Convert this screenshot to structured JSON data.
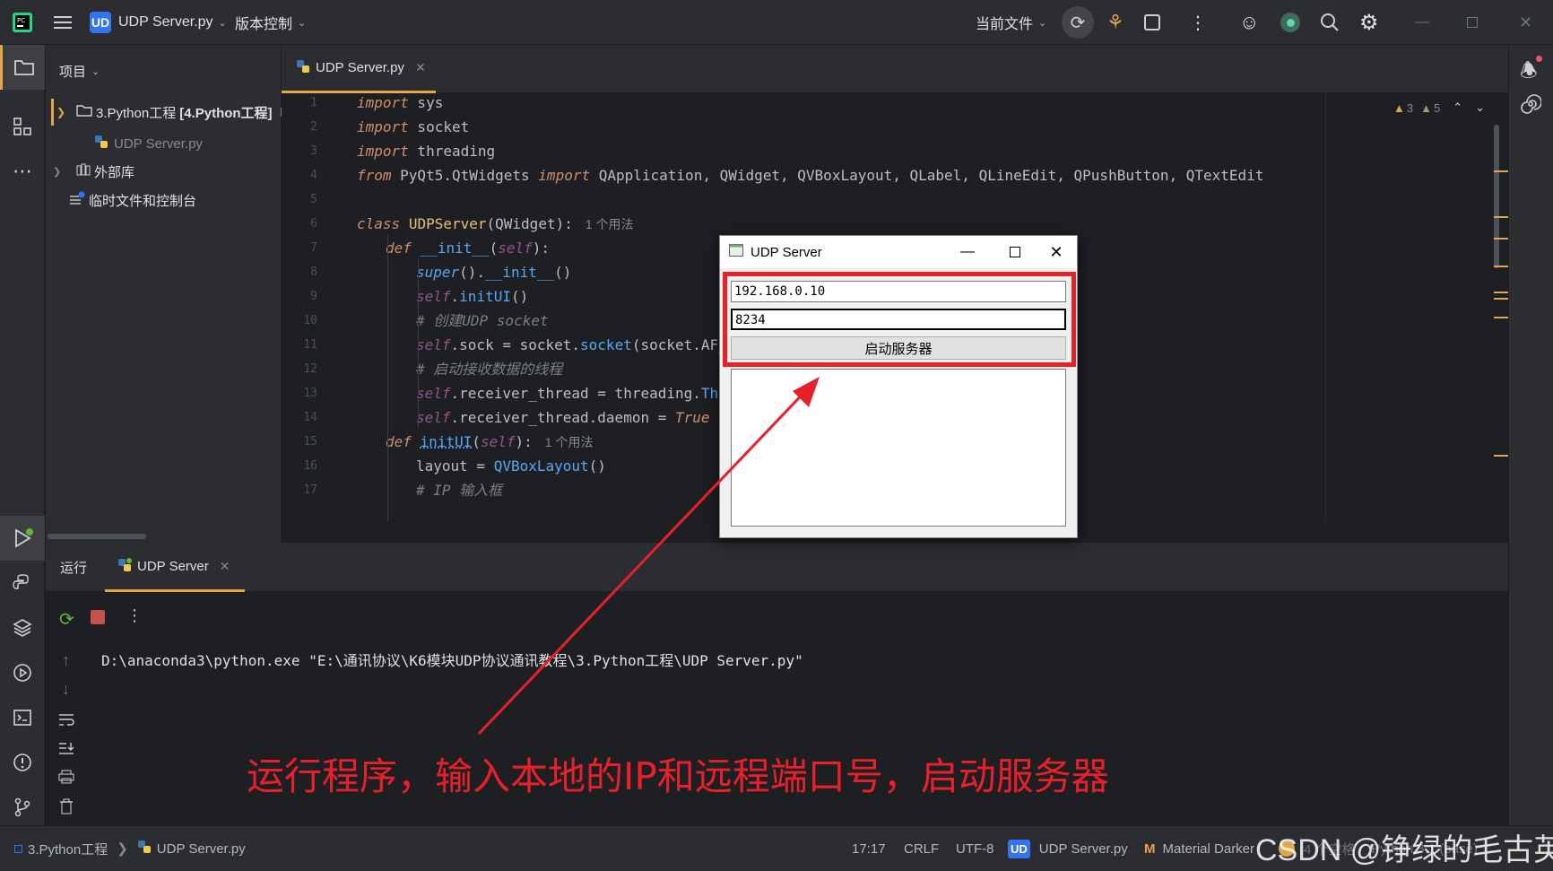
{
  "titlebar": {
    "project_badge": "UD",
    "project_name": "UDP Server.py",
    "vcs_menu": "版本控制",
    "run_config": "当前文件"
  },
  "project_panel": {
    "title": "项目",
    "root_label": "3.Python工程",
    "root_bold": "[4.Python工程]",
    "root_suffix": "E",
    "file_item": "UDP Server.py",
    "external_libs": "外部库",
    "scratches": "临时文件和控制台"
  },
  "editor": {
    "tab_label": "UDP Server.py",
    "warnings_count": "3",
    "weak_warnings_count": "5",
    "line_numbers": [
      "1",
      "2",
      "3",
      "4",
      "5",
      "6",
      "7",
      "8",
      "9",
      "10",
      "11",
      "12",
      "13",
      "14",
      "15",
      "16",
      "17"
    ],
    "usage_hint_1": "1 个用法",
    "usage_hint_2": "1 个用法"
  },
  "udp_window": {
    "title": "UDP Server",
    "ip_value": "192.168.0.10",
    "port_value": "8234",
    "start_button": "启动服务器"
  },
  "run_panel": {
    "run_label": "运行",
    "tab_label": "UDP Server",
    "console_line": "D:\\anaconda3\\python.exe \"E:\\通讯协议\\K6模块UDP协议通讯教程\\3.Python工程\\UDP Server.py\""
  },
  "annotation": "运行程序，输入本地的IP和远程端口号，启动服务器",
  "statusbar": {
    "breadcrumb_project": "3.Python工程",
    "breadcrumb_file": "UDP Server.py",
    "position": "17:17",
    "line_ending": "CRLF",
    "encoding": "UTF-8",
    "badge": "UD",
    "file_label": "UDP Server.py",
    "theme": "Material Darker",
    "interpreter_partial": "Python 3.1 (base)",
    "extra_partial": "4 个空格"
  },
  "watermark": "CSDN @铮绿的毛古英",
  "colors": {
    "accent": "#3574f0",
    "annotation_red": "#e8202a",
    "ide_bg": "#1e1f22",
    "panel_bg": "#2b2d30"
  }
}
